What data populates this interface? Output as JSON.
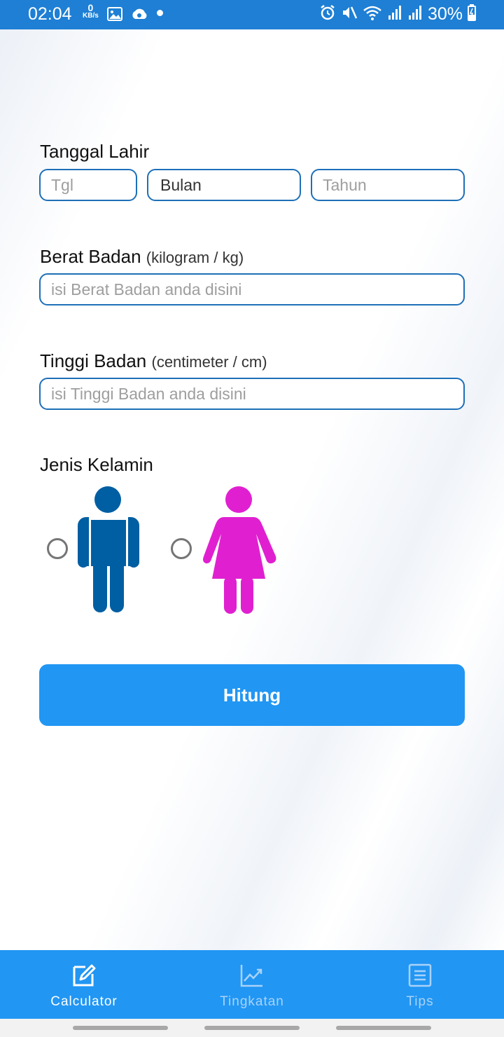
{
  "status_bar": {
    "time": "02:04",
    "net_speed_value": "0",
    "net_speed_unit": "KB/s",
    "battery": "30%"
  },
  "form": {
    "birth_date": {
      "label": "Tanggal Lahir",
      "day_placeholder": "Tgl",
      "month_value": "Bulan",
      "year_placeholder": "Tahun"
    },
    "weight": {
      "label": "Berat Badan",
      "unit": "(kilogram / kg)",
      "placeholder": "isi Berat Badan anda disini"
    },
    "height": {
      "label": "Tinggi Badan",
      "unit": "(centimeter / cm)",
      "placeholder": "isi Tinggi Badan anda disini"
    },
    "gender": {
      "label": "Jenis Kelamin",
      "male_color": "#005ea2",
      "female_color": "#e020d0"
    },
    "submit_label": "Hitung"
  },
  "bottom_nav": {
    "items": [
      {
        "label": "Calculator",
        "icon": "edit-icon",
        "active": true
      },
      {
        "label": "Tingkatan",
        "icon": "chart-icon",
        "active": false
      },
      {
        "label": "Tips",
        "icon": "list-icon",
        "active": false
      }
    ]
  },
  "colors": {
    "accent": "#2196f3",
    "status_bar": "#1e7fd4",
    "field_border": "#1e6fb8"
  }
}
